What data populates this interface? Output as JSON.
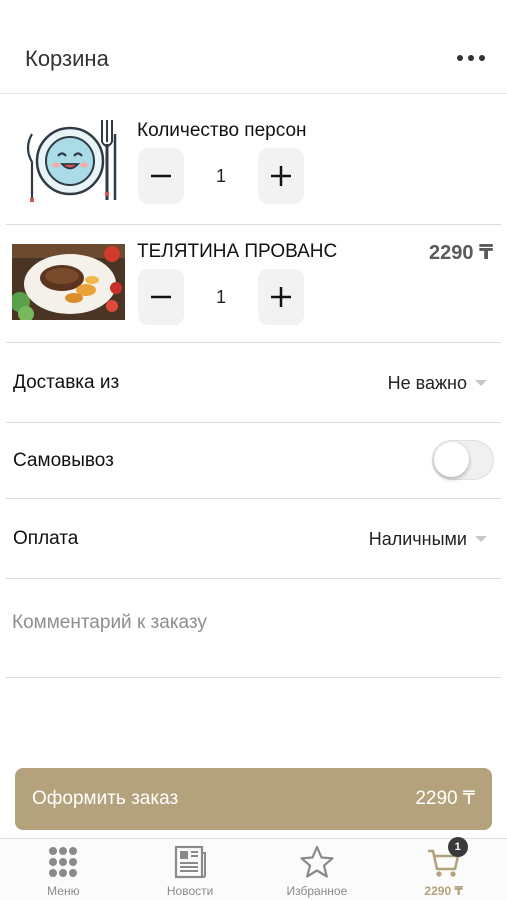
{
  "header": {
    "title": "Корзина",
    "more_icon": "more-dots-icon"
  },
  "persons": {
    "label": "Количество персон",
    "quantity": "1",
    "minus_icon": "minus-icon",
    "plus_icon": "plus-icon"
  },
  "cart_items": [
    {
      "name": "ТЕЛЯТИНА ПРОВАНС",
      "price": "2290 ₸",
      "quantity": "1"
    }
  ],
  "settings": {
    "delivery": {
      "label": "Доставка из",
      "value": "Не важно"
    },
    "pickup": {
      "label": "Самовывоз",
      "enabled": false
    },
    "payment": {
      "label": "Оплата",
      "value": "Наличными"
    }
  },
  "comment": {
    "placeholder": "Комментарий к заказу",
    "value": ""
  },
  "checkout": {
    "label": "Оформить заказ",
    "total": "2290 ₸"
  },
  "tabbar": {
    "tabs": [
      {
        "label": "Меню",
        "icon": "grid-icon",
        "active": false
      },
      {
        "label": "Новости",
        "icon": "newspaper-icon",
        "active": false
      },
      {
        "label": "Избранное",
        "icon": "star-icon",
        "active": false
      },
      {
        "label": "2290 ₸",
        "icon": "cart-icon",
        "active": true,
        "badge": "1"
      }
    ]
  },
  "colors": {
    "accent": "#b3a27c",
    "badge": "#3a3a3a",
    "divider": "#dcdcdc"
  }
}
